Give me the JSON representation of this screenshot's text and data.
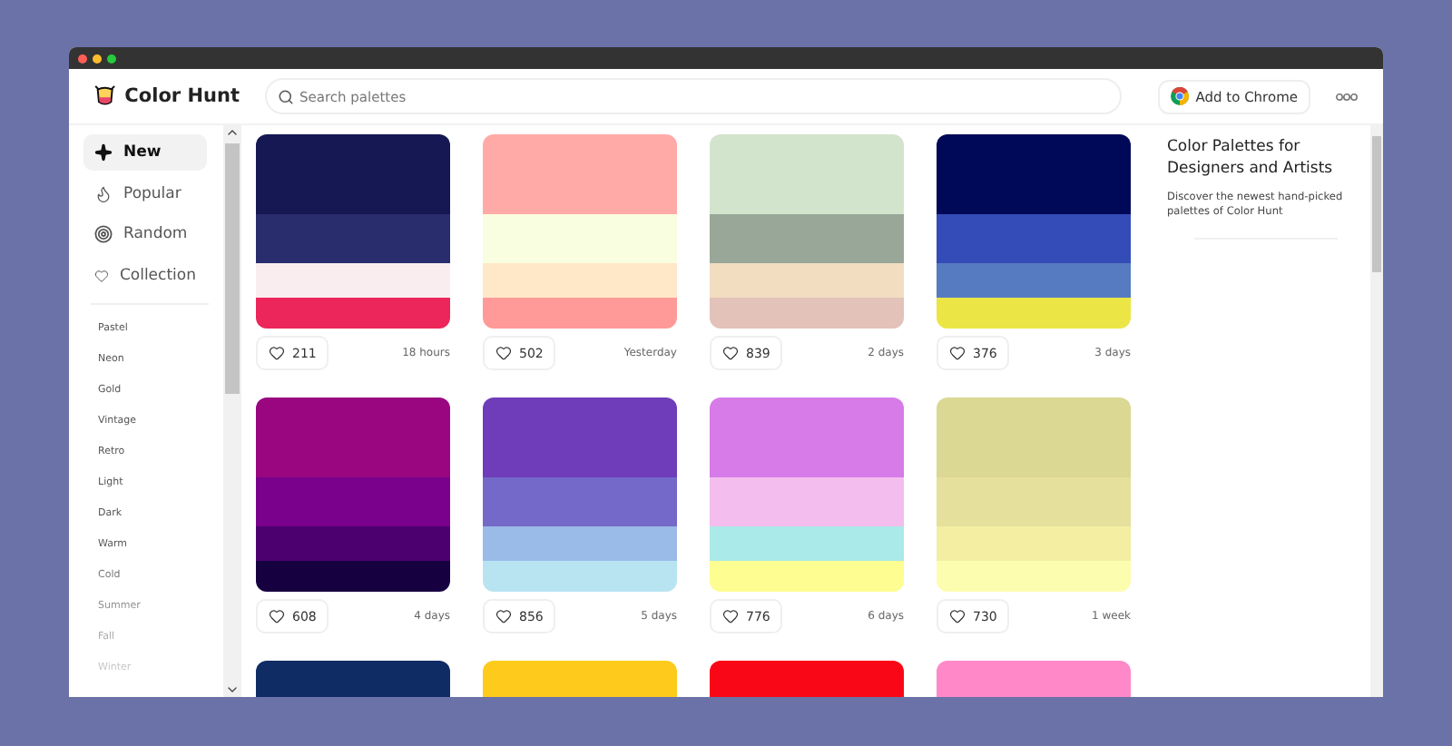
{
  "brand": {
    "name": "Color Hunt"
  },
  "search": {
    "placeholder": "Search palettes"
  },
  "header_actions": {
    "extension_button": "Add to Chrome"
  },
  "nav": [
    {
      "kind": "new",
      "label": "New",
      "selected": true
    },
    {
      "kind": "popular",
      "label": "Popular",
      "selected": false
    },
    {
      "kind": "random",
      "label": "Random",
      "selected": false
    },
    {
      "kind": "collection",
      "label": "Collection",
      "selected": false
    }
  ],
  "tags": [
    "Pastel",
    "Neon",
    "Gold",
    "Vintage",
    "Retro",
    "Light",
    "Dark",
    "Warm",
    "Cold",
    "Summer",
    "Fall",
    "Winter"
  ],
  "palettes": [
    {
      "colors": [
        {
          "color": "#161853"
        },
        {
          "color": "#292c6d"
        },
        {
          "color": "#faedf0"
        },
        {
          "color": "#ec255a"
        }
      ],
      "likes": "211",
      "age": "18 hours"
    },
    {
      "colors": [
        {
          "color": "#ffaaa7"
        },
        {
          "color": "#fafee0"
        },
        {
          "color": "#ffe8c8"
        },
        {
          "color": "#ff9a98"
        }
      ],
      "likes": "502",
      "age": "Yesterday"
    },
    {
      "colors": [
        {
          "color": "#d3e4cd"
        },
        {
          "color": "#99a799"
        },
        {
          "color": "#f2ddc1"
        },
        {
          "color": "#e2c2b9"
        }
      ],
      "likes": "839",
      "age": "2 days"
    },
    {
      "colors": [
        {
          "color": "#000957"
        },
        {
          "color": "#344cb7"
        },
        {
          "color": "#577bc1"
        },
        {
          "color": "#ebe645"
        }
      ],
      "likes": "376",
      "age": "3 days"
    },
    {
      "colors": [
        {
          "color": "#9a0680"
        },
        {
          "color": "#79018c"
        },
        {
          "color": "#4c0070"
        },
        {
          "color": "#160040"
        }
      ],
      "likes": "608",
      "age": "4 days"
    },
    {
      "colors": [
        {
          "color": "#6f3cba"
        },
        {
          "color": "#7469c9"
        },
        {
          "color": "#9abae8"
        },
        {
          "color": "#b8e4f2"
        }
      ],
      "likes": "856",
      "age": "5 days"
    },
    {
      "colors": [
        {
          "color": "#d67be8"
        },
        {
          "color": "#f3bdee"
        },
        {
          "color": "#aaeae8"
        },
        {
          "color": "#fdfd91"
        }
      ],
      "likes": "776",
      "age": "6 days"
    },
    {
      "colors": [
        {
          "color": "#dad893"
        },
        {
          "color": "#e5e09c"
        },
        {
          "color": "#f3eea2"
        },
        {
          "color": "#fdfdb0"
        }
      ],
      "likes": "730",
      "age": "1 week"
    },
    {
      "colors": [
        {
          "color": "#0f2c64"
        }
      ]
    },
    {
      "colors": [
        {
          "color": "#fecb1c"
        }
      ]
    },
    {
      "colors": [
        {
          "color": "#fa0717"
        }
      ]
    },
    {
      "colors": [
        {
          "color": "#ff88c8"
        }
      ]
    }
  ],
  "about": {
    "title": "Color Palettes for Designers and Artists",
    "text": "Discover the newest hand-picked palettes of Color Hunt"
  }
}
